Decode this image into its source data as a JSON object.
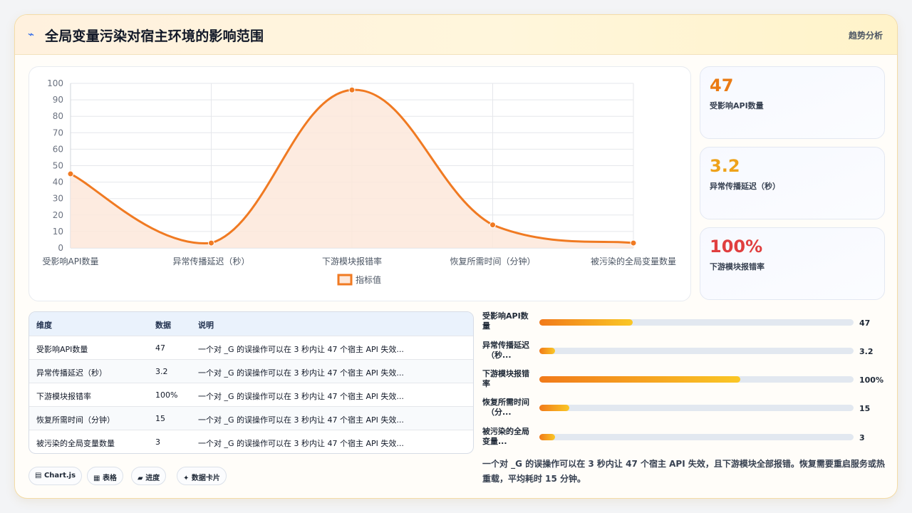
{
  "header": {
    "icon": "lightning-icon",
    "title": "全局变量污染对宿主环境的影响范围",
    "link": "趋势分析"
  },
  "chart_data": {
    "type": "line",
    "categories": [
      "受影响API数量",
      "异常传播延迟（秒）",
      "下游模块报错率",
      "恢复所需时间（分钟）",
      "被污染的全局变量数量"
    ],
    "series": [
      {
        "name": "指标值",
        "values": [
          45,
          3,
          96,
          14,
          3
        ]
      }
    ],
    "ylim": [
      0,
      100
    ],
    "yticks": [
      "0",
      "10",
      "20",
      "30",
      "40",
      "50",
      "60",
      "70",
      "80",
      "90",
      "100"
    ],
    "fill": true,
    "smooth": true,
    "grid": true,
    "legend": "bottom",
    "colors": {
      "line": "#f07a22",
      "area": "#fde8db"
    }
  },
  "stats": [
    {
      "value": "47",
      "label": "受影响API数量",
      "color": "#ea7b14"
    },
    {
      "value": "3.2",
      "label": "异常传播延迟（秒）",
      "color": "#eea21a"
    },
    {
      "value": "100%",
      "label": "下游模块报错率",
      "color": "#e03f3f"
    }
  ],
  "table": {
    "headers": [
      "维度",
      "数据",
      "说明"
    ],
    "rows": [
      [
        "受影响API数量",
        "47",
        "一个对 _G 的误操作可以在 3 秒内让 47 个宿主 API 失效..."
      ],
      [
        "异常传播延迟（秒）",
        "3.2",
        "一个对 _G 的误操作可以在 3 秒内让 47 个宿主 API 失效..."
      ],
      [
        "下游模块报错率",
        "100%",
        "一个对 _G 的误操作可以在 3 秒内让 47 个宿主 API 失效..."
      ],
      [
        "恢复所需时间（分钟）",
        "15",
        "一个对 _G 的误操作可以在 3 秒内让 47 个宿主 API 失效..."
      ],
      [
        "被污染的全局变量数量",
        "3",
        "一个对 _G 的误操作可以在 3 秒内让 47 个宿主 API 失效..."
      ]
    ]
  },
  "bars": [
    {
      "label1": "受影响API数",
      "label2": "量",
      "value": "47",
      "fraction": 0.297
    },
    {
      "label1": "异常传播延迟",
      "label2": "（秒...",
      "value": "3.2",
      "fraction": 0.05
    },
    {
      "label1": "下游模块报错",
      "label2": "率",
      "value": "100%",
      "fraction": 0.64
    },
    {
      "label1": "恢复所需时间",
      "label2": "（分...",
      "value": "15",
      "fraction": 0.095
    },
    {
      "label1": "被污染的全局",
      "label2": "变量...",
      "value": "3",
      "fraction": 0.05
    }
  ],
  "summary": "一个对 _G 的误操作可以在 3 秒内让 47 个宿主 API 失效，且下游模块全部报错。恢复需要重启服务或热重载，平均耗时 15 分钟。",
  "chips": [
    {
      "icon": "chart-icon",
      "glyph": "▤",
      "label": "Chart.js"
    },
    {
      "icon": "table-icon",
      "glyph": "▦",
      "label": "表格"
    },
    {
      "icon": "progress-icon",
      "glyph": "▰",
      "label": "进度"
    },
    {
      "icon": "sparkle-icon",
      "glyph": "✦",
      "label": "数据卡片"
    }
  ]
}
